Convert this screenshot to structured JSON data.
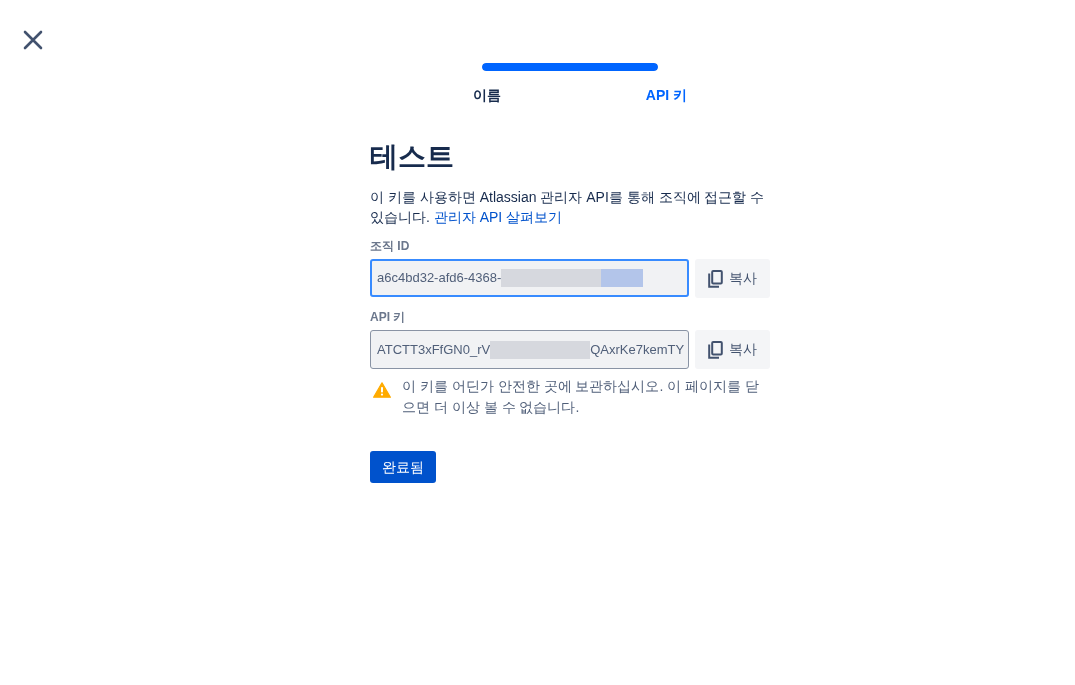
{
  "stepper": {
    "level": 1,
    "steps": [
      {
        "label": "이름",
        "selected": false
      },
      {
        "label": "API 키",
        "selected": true
      }
    ]
  },
  "title": "테스트",
  "description": {
    "text": "이 키를 사용하면 Atlassian 관리자 API를 통해 조직에 접근할 수 있습니다.",
    "link": "관리자 API 살펴보기"
  },
  "fields": [
    {
      "label": "조직 ID",
      "focused": true,
      "segments": [
        {
          "kind": "text",
          "text": "a6c4bd32-afd6-4368-"
        },
        {
          "kind": "redaction"
        },
        {
          "kind": "selection"
        }
      ],
      "copy_button": "복사"
    },
    {
      "label": "API 키",
      "focused": false,
      "segments": [
        {
          "kind": "text",
          "text": "ATCTT3xFfGN0_rV"
        },
        {
          "kind": "redaction"
        },
        {
          "kind": "text",
          "text": "QAxrKe7kemTY"
        }
      ],
      "copy_button": "복사"
    }
  ],
  "warning": "이 키를 어딘가 안전한 곳에 보관하십시오. 이 페이지를 닫으면 더 이상 볼 수 없습니다.",
  "done_button": "완료됨"
}
